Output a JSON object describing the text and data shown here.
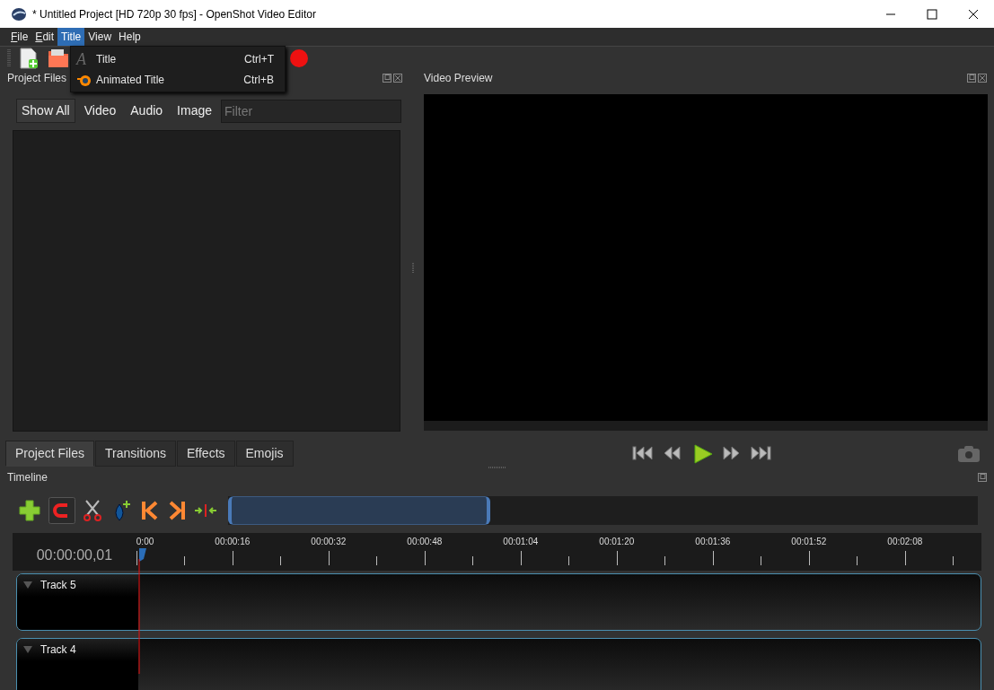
{
  "window": {
    "title": "* Untitled Project [HD 720p 30 fps] - OpenShot Video Editor"
  },
  "menu_bar": [
    {
      "label": "File",
      "mnemonic_underlined": true,
      "selected": false
    },
    {
      "label": "Edit",
      "mnemonic_underlined": true,
      "selected": false
    },
    {
      "label": "Title",
      "selected": true
    },
    {
      "label": "View",
      "selected": false
    },
    {
      "label": "Help",
      "selected": false
    }
  ],
  "title_menu": [
    {
      "kind": "text",
      "icon": "A",
      "label": "Title",
      "shortcut": "Ctrl+T"
    },
    {
      "kind": "animated",
      "label": "Animated Title",
      "shortcut": "Ctrl+B"
    }
  ],
  "project_files": {
    "title": "Project Files",
    "filters": [
      {
        "label": "Show All",
        "selected": true
      },
      {
        "label": "Video",
        "selected": false
      },
      {
        "label": "Audio",
        "selected": false
      },
      {
        "label": "Image",
        "selected": false
      }
    ],
    "search": {
      "placeholder": "Filter"
    },
    "tabs": [
      {
        "label": "Project Files",
        "selected": true
      },
      {
        "label": "Transitions",
        "selected": false
      },
      {
        "label": "Effects",
        "selected": false
      },
      {
        "label": "Emojis",
        "selected": false
      }
    ]
  },
  "video_preview": {
    "title": "Video Preview"
  },
  "timeline": {
    "title": "Timeline",
    "zoom": {
      "level": 0.35
    },
    "timecode": "00:00:00,01",
    "ruler": [
      "0:00",
      "00:00:16",
      "00:00:32",
      "00:00:48",
      "00:01:04",
      "00:01:20",
      "00:01:36",
      "00:01:52",
      "00:02:08"
    ],
    "tracks": [
      {
        "name": "Track 5"
      },
      {
        "name": "Track 4"
      }
    ]
  }
}
